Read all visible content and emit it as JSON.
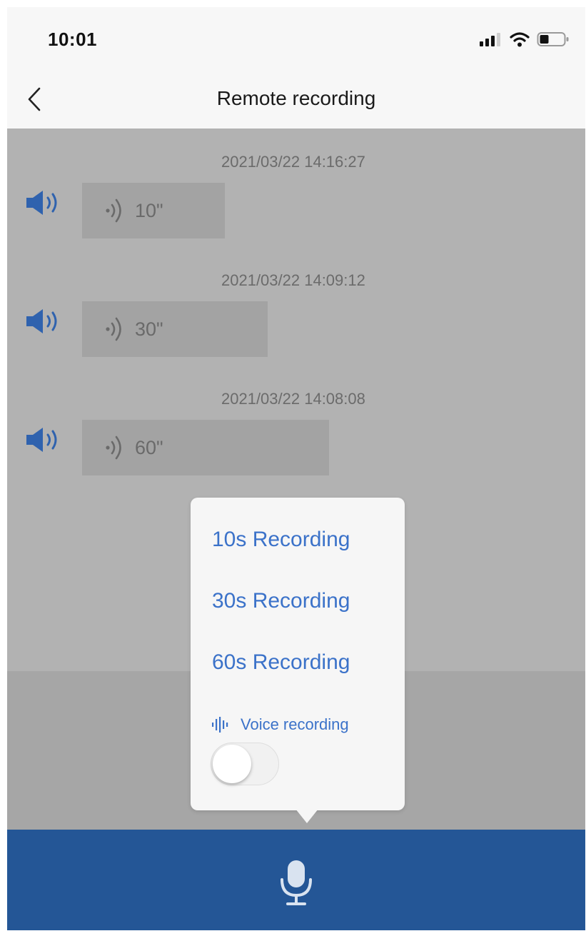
{
  "status": {
    "time": "10:01"
  },
  "nav": {
    "title": "Remote recording"
  },
  "records": [
    {
      "timestamp": "2021/03/22 14:16:27",
      "duration": "10\""
    },
    {
      "timestamp": "2021/03/22 14:09:12",
      "duration": "30\""
    },
    {
      "timestamp": "2021/03/22 14:08:08",
      "duration": "60\""
    }
  ],
  "popover": {
    "options": [
      "10s Recording",
      "30s Recording",
      "60s Recording"
    ],
    "voice_label": "Voice recording",
    "toggle_on": false
  },
  "icons": {
    "signal": "cellular-signal-icon",
    "wifi": "wifi-icon",
    "battery": "battery-icon",
    "back": "chevron-left-icon",
    "speaker": "speaker-icon",
    "wave": "sound-wave-icon",
    "voice": "voice-waveform-icon",
    "mic": "microphone-icon"
  },
  "colors": {
    "accent": "#3b72c9",
    "speaker": "#2f62ae",
    "bottom_bar": "#245696",
    "overlay": "#b2b2b2"
  }
}
